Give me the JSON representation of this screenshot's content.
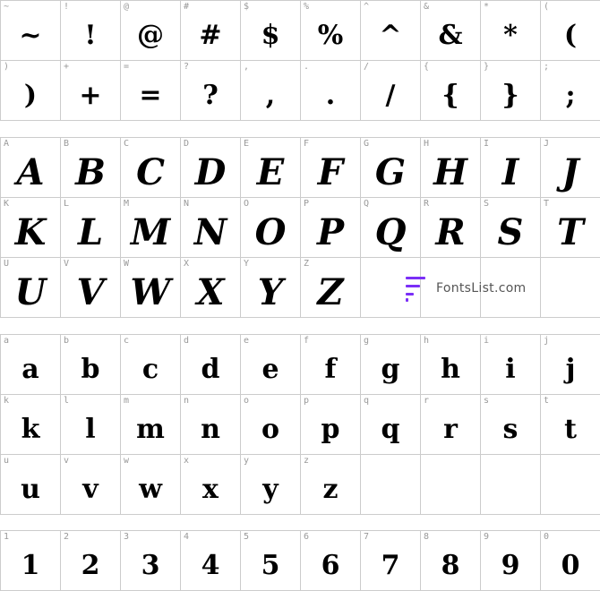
{
  "symbols": [
    {
      "key": "~",
      "glyph": "~"
    },
    {
      "key": "!",
      "glyph": "!"
    },
    {
      "key": "@",
      "glyph": "@"
    },
    {
      "key": "#",
      "glyph": "#"
    },
    {
      "key": "$",
      "glyph": "$"
    },
    {
      "key": "%",
      "glyph": "%"
    },
    {
      "key": "^",
      "glyph": "^"
    },
    {
      "key": "&",
      "glyph": "&"
    },
    {
      "key": "*",
      "glyph": "*"
    },
    {
      "key": "(",
      "glyph": "("
    },
    {
      "key": ")",
      "glyph": ")"
    },
    {
      "key": "+",
      "glyph": "+"
    },
    {
      "key": "=",
      "glyph": "="
    },
    {
      "key": "?",
      "glyph": "?"
    },
    {
      "key": ",",
      "glyph": ","
    },
    {
      "key": ".",
      "glyph": "."
    },
    {
      "key": "/",
      "glyph": "/"
    },
    {
      "key": "{",
      "glyph": "{"
    },
    {
      "key": "}",
      "glyph": "}"
    },
    {
      "key": ";",
      "glyph": ";"
    }
  ],
  "uppercase": [
    {
      "key": "A",
      "glyph": "A"
    },
    {
      "key": "B",
      "glyph": "B"
    },
    {
      "key": "C",
      "glyph": "C"
    },
    {
      "key": "D",
      "glyph": "D"
    },
    {
      "key": "E",
      "glyph": "E"
    },
    {
      "key": "F",
      "glyph": "F"
    },
    {
      "key": "G",
      "glyph": "G"
    },
    {
      "key": "H",
      "glyph": "H"
    },
    {
      "key": "I",
      "glyph": "I"
    },
    {
      "key": "J",
      "glyph": "J"
    },
    {
      "key": "K",
      "glyph": "K"
    },
    {
      "key": "L",
      "glyph": "L"
    },
    {
      "key": "M",
      "glyph": "M"
    },
    {
      "key": "N",
      "glyph": "N"
    },
    {
      "key": "O",
      "glyph": "O"
    },
    {
      "key": "P",
      "glyph": "P"
    },
    {
      "key": "Q",
      "glyph": "Q"
    },
    {
      "key": "R",
      "glyph": "R"
    },
    {
      "key": "S",
      "glyph": "S"
    },
    {
      "key": "T",
      "glyph": "T"
    },
    {
      "key": "U",
      "glyph": "U"
    },
    {
      "key": "V",
      "glyph": "V"
    },
    {
      "key": "W",
      "glyph": "W"
    },
    {
      "key": "X",
      "glyph": "X"
    },
    {
      "key": "Y",
      "glyph": "Y"
    },
    {
      "key": "Z",
      "glyph": "Z"
    }
  ],
  "lowercase": [
    {
      "key": "a",
      "glyph": "a"
    },
    {
      "key": "b",
      "glyph": "b"
    },
    {
      "key": "c",
      "glyph": "c"
    },
    {
      "key": "d",
      "glyph": "d"
    },
    {
      "key": "e",
      "glyph": "e"
    },
    {
      "key": "f",
      "glyph": "f"
    },
    {
      "key": "g",
      "glyph": "g"
    },
    {
      "key": "h",
      "glyph": "h"
    },
    {
      "key": "i",
      "glyph": "i"
    },
    {
      "key": "j",
      "glyph": "j"
    },
    {
      "key": "k",
      "glyph": "k"
    },
    {
      "key": "l",
      "glyph": "l"
    },
    {
      "key": "m",
      "glyph": "m"
    },
    {
      "key": "n",
      "glyph": "n"
    },
    {
      "key": "o",
      "glyph": "o"
    },
    {
      "key": "p",
      "glyph": "p"
    },
    {
      "key": "q",
      "glyph": "q"
    },
    {
      "key": "r",
      "glyph": "r"
    },
    {
      "key": "s",
      "glyph": "s"
    },
    {
      "key": "t",
      "glyph": "t"
    },
    {
      "key": "u",
      "glyph": "u"
    },
    {
      "key": "v",
      "glyph": "v"
    },
    {
      "key": "w",
      "glyph": "w"
    },
    {
      "key": "x",
      "glyph": "x"
    },
    {
      "key": "y",
      "glyph": "y"
    },
    {
      "key": "z",
      "glyph": "z"
    }
  ],
  "numbers": [
    {
      "key": "1",
      "glyph": "1"
    },
    {
      "key": "2",
      "glyph": "2"
    },
    {
      "key": "3",
      "glyph": "3"
    },
    {
      "key": "4",
      "glyph": "4"
    },
    {
      "key": "5",
      "glyph": "5"
    },
    {
      "key": "6",
      "glyph": "6"
    },
    {
      "key": "7",
      "glyph": "7"
    },
    {
      "key": "8",
      "glyph": "8"
    },
    {
      "key": "9",
      "glyph": "9"
    },
    {
      "key": "0",
      "glyph": "0"
    }
  ],
  "brand": {
    "text": "FontsList.com",
    "accent": "#7b2ff7"
  }
}
